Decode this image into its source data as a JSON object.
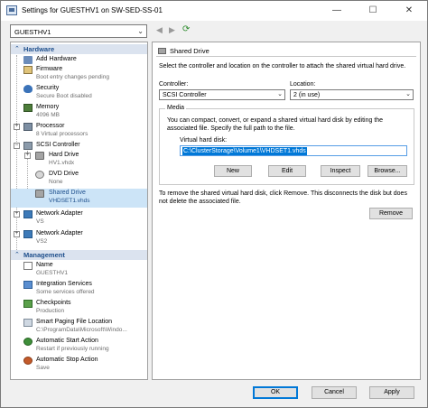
{
  "window": {
    "title": "Settings for GUESTHV1 on SW-SED-SS-01",
    "minimize": "—",
    "maximize": "☐",
    "close": "✕"
  },
  "vm_selector": {
    "value": "GUESTHV1"
  },
  "nav": {
    "back": "◀",
    "forward": "▶",
    "refresh": "⟳"
  },
  "tree": {
    "hardware_header": "Hardware",
    "management_header": "Management",
    "items": {
      "add_hardware": {
        "label": "Add Hardware"
      },
      "firmware": {
        "label": "Firmware",
        "sub": "Boot entry changes pending"
      },
      "security": {
        "label": "Security",
        "sub": "Secure Boot disabled"
      },
      "memory": {
        "label": "Memory",
        "sub": "4096 MB"
      },
      "processor": {
        "label": "Processor",
        "sub": "8 Virtual processors"
      },
      "scsi": {
        "label": "SCSI Controller"
      },
      "hard_drive": {
        "label": "Hard Drive",
        "sub": "HV1.vhdx"
      },
      "dvd": {
        "label": "DVD Drive",
        "sub": "None"
      },
      "shared_drive": {
        "label": "Shared Drive",
        "sub": "VHDSET1.vhds"
      },
      "net1": {
        "label": "Network Adapter",
        "sub": "VS"
      },
      "net2": {
        "label": "Network Adapter",
        "sub": "VS2"
      },
      "name": {
        "label": "Name",
        "sub": "GUESTHV1"
      },
      "integration": {
        "label": "Integration Services",
        "sub": "Some services offered"
      },
      "checkpoints": {
        "label": "Checkpoints",
        "sub": "Production"
      },
      "paging": {
        "label": "Smart Paging File Location",
        "sub": "C:\\ProgramData\\Microsoft\\Windo..."
      },
      "auto_start": {
        "label": "Automatic Start Action",
        "sub": "Restart if previously running"
      },
      "auto_stop": {
        "label": "Automatic Stop Action",
        "sub": "Save"
      }
    }
  },
  "panel": {
    "header": "Shared Drive",
    "intro": "Select the controller and location on the controller to attach the shared virtual hard drive.",
    "controller_label": "Controller:",
    "controller_value": "SCSI Controller",
    "location_label": "Location:",
    "location_value": "2 (in use)",
    "media_legend": "Media",
    "media_text": "You can compact, convert, or expand a shared virtual hard disk by editing the associated file. Specify the full path to the file.",
    "vhd_label": "Virtual hard disk:",
    "vhd_path": "C:\\ClusterStorage\\Volume1\\VHDSET1.vhds",
    "buttons": {
      "new": "New",
      "edit": "Edit",
      "inspect": "Inspect",
      "browse": "Browse..."
    },
    "remove_text": "To remove the shared virtual hard disk, click Remove. This disconnects the disk but does not delete the associated file.",
    "remove_button": "Remove"
  },
  "footer": {
    "ok": "OK",
    "cancel": "Cancel",
    "apply": "Apply"
  }
}
